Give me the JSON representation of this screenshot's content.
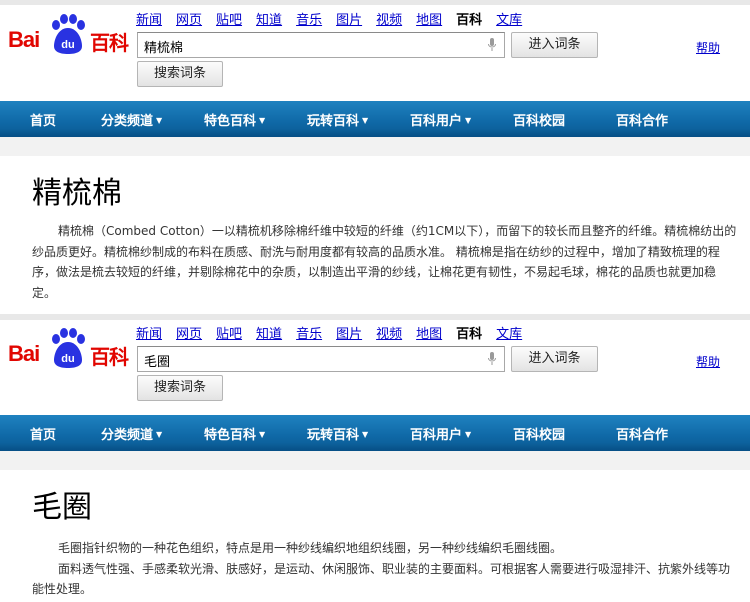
{
  "logo": {
    "bai": "Bai",
    "du": "du",
    "baike": "百科"
  },
  "top_links": [
    "新闻",
    "网页",
    "贴吧",
    "知道",
    "音乐",
    "图片",
    "视频",
    "地图",
    "百科",
    "文库"
  ],
  "active_link": "百科",
  "enter_button": "进入词条",
  "search_button": "搜索词条",
  "help_link": "帮助",
  "nav": {
    "items": [
      {
        "label": "首页",
        "has_caret": false
      },
      {
        "label": "分类频道",
        "has_caret": true
      },
      {
        "label": "特色百科",
        "has_caret": true
      },
      {
        "label": "玩转百科",
        "has_caret": true
      },
      {
        "label": "百科用户",
        "has_caret": true
      },
      {
        "label": "百科校园",
        "has_caret": false
      },
      {
        "label": "百科合作",
        "has_caret": false
      }
    ],
    "caret_glyph": "▼"
  },
  "panels": [
    {
      "search_value": "精梳棉",
      "title": "精梳棉",
      "paragraphs": [
        "精梳棉（Combed Cotton）一以精梳机移除棉纤维中较短的纤维（约1CM以下），而留下的较长而且整齐的纤维。精梳棉纺出的纱品质更好。精梳棉纱制成的布料在质感、耐洗与耐用度都有较高的品质水准。 精梳棉是指在纺纱的过程中，增加了精致梳理的程序，做法是梳去较短的纤维，并剔除棉花中的杂质，以制造出平滑的纱线，让棉花更有韧性，不易起毛球，棉花的品质也就更加稳定。"
      ]
    },
    {
      "search_value": "毛圈",
      "title": "毛圈",
      "paragraphs": [
        "毛圈指针织物的一种花色组织，特点是用一种纱线编织地组织线圈，另一种纱线编织毛圈线圈。",
        "面料透气性强、手感柔软光滑、肤感好，是运动、休闲服饰、职业装的主要面料。可根据客人需要进行吸湿排汗、抗紫外线等功能性处理。"
      ]
    }
  ],
  "colors": {
    "nav_blue": "#1476b4",
    "logo_red": "#e10601",
    "logo_blue": "#2932e1",
    "link_blue": "#0000cc"
  }
}
